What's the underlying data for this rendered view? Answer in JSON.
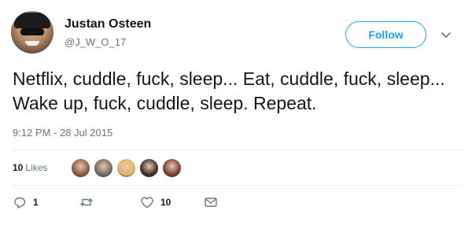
{
  "user": {
    "name": "Justan Osteen",
    "handle": "@J_W_O_17"
  },
  "follow_button": {
    "label": "Follow"
  },
  "tweet": {
    "text": "Netflix, cuddle, fuck, sleep... Eat, cuddle, fuck, sleep... Wake up, fuck, cuddle, sleep. Repeat.",
    "timestamp": "9:12 PM - 28 Jul 2015"
  },
  "stats": {
    "likes_count": "10",
    "likes_label": "Likes"
  },
  "likers": [
    {
      "color": "#8a5a3c"
    },
    {
      "color": "#6f6a66"
    },
    {
      "color": "#e0b36a"
    },
    {
      "color": "#3b2f2a"
    },
    {
      "color": "#7a3f33"
    }
  ],
  "actions": {
    "reply_count": "1",
    "retweet_count": "",
    "like_count": "10"
  },
  "colors": {
    "accent": "#1da1f2",
    "secondary_text": "#657786"
  }
}
